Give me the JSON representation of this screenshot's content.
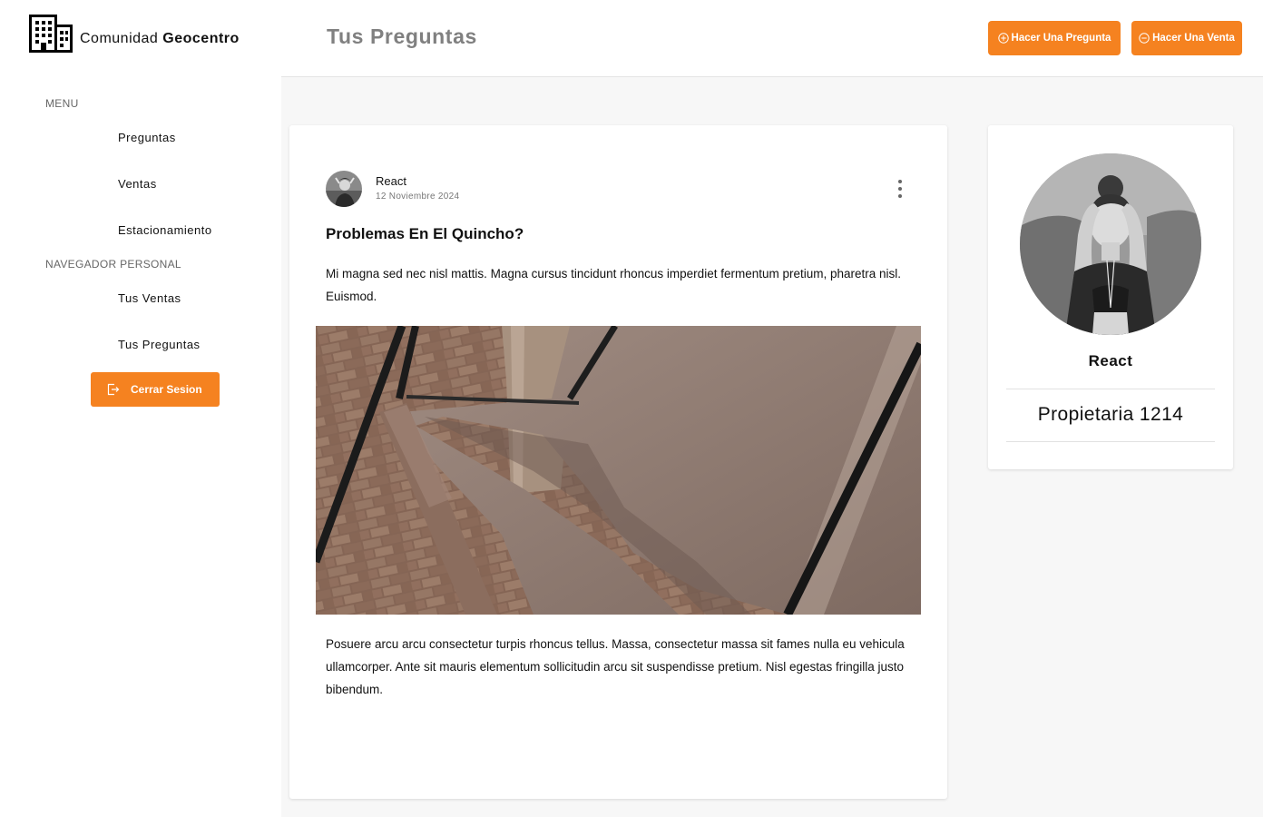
{
  "app": {
    "name_regular": "Comunidad",
    "name_bold": "Geocentro"
  },
  "sidebar": {
    "menu_label": "MENU",
    "menu_items": [
      {
        "label": "Preguntas"
      },
      {
        "label": "Ventas"
      },
      {
        "label": "Estacionamiento"
      }
    ],
    "personal_label": "NAVEGADOR PERSONAL",
    "personal_items": [
      {
        "label": "Tus Ventas"
      },
      {
        "label": "Tus Preguntas"
      }
    ],
    "logout_label": "Cerrar Sesion",
    "logout_icon": "logout-icon"
  },
  "header": {
    "title": "Tus Preguntas",
    "ask_button": "Hacer Una Pregunta",
    "ask_icon": "plus-circle-icon",
    "sell_button": "Hacer Una Venta",
    "sell_icon": "minus-circle-icon"
  },
  "post": {
    "author": "React",
    "date": "12 Noviembre 2024",
    "title": "Problemas En El Quincho?",
    "paragraph_1": "Mi magna sed nec nisl mattis. Magna cursus tincidunt rhoncus imperdiet fermentum pretium, pharetra nisl. Euismod.",
    "paragraph_2": "Posuere arcu arcu consectetur turpis rhoncus tellus. Massa, consectetur massa sit fames nulla eu vehicula ullamcorper. Ante sit mauris elementum sollicitudin arcu sit suspendisse pretium. Nisl egestas fringilla justo bibendum.",
    "menu_icon": "more-vertical-icon"
  },
  "profile": {
    "name": "React",
    "unit": "Propietaria 1214"
  },
  "colors": {
    "accent": "#f58220",
    "background": "#f7f7f7",
    "title_gray": "#808080"
  }
}
